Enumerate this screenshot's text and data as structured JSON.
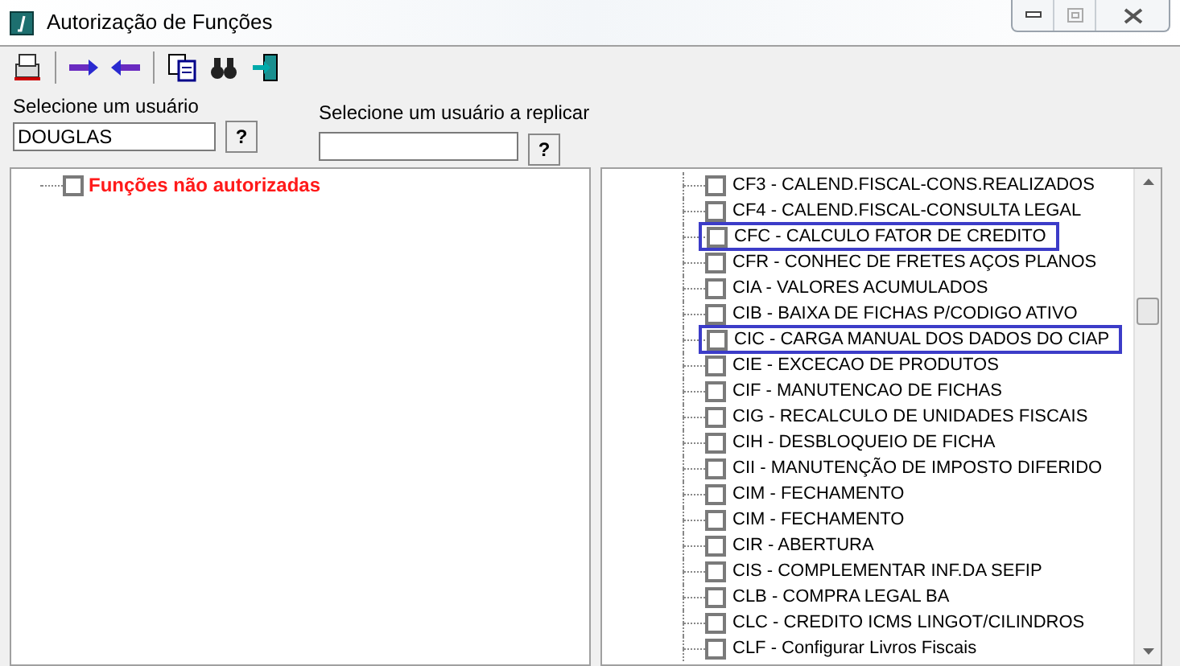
{
  "window": {
    "title": "Autorização de Funções"
  },
  "user_field": {
    "label": "Selecione um usuário",
    "value": "DOUGLAS",
    "button": "?"
  },
  "replicate_field": {
    "label": "Selecione um usuário a replicar",
    "button": "?"
  },
  "left_tree": {
    "items": [
      {
        "label": "Funções não autorizadas",
        "checked": false
      }
    ]
  },
  "right_tree": {
    "items": [
      {
        "label": "CF3 - CALEND.FISCAL-CONS.REALIZADOS",
        "checked": false,
        "highlighted": false
      },
      {
        "label": "CF4 - CALEND.FISCAL-CONSULTA LEGAL",
        "checked": false,
        "highlighted": false
      },
      {
        "label": "CFC - CALCULO FATOR DE CREDITO",
        "checked": false,
        "highlighted": true
      },
      {
        "label": "CFR - CONHEC DE FRETES AÇOS PLANOS",
        "checked": false,
        "highlighted": false
      },
      {
        "label": "CIA - VALORES ACUMULADOS",
        "checked": false,
        "highlighted": false
      },
      {
        "label": "CIB - BAIXA DE FICHAS P/CODIGO ATIVO",
        "checked": false,
        "highlighted": false
      },
      {
        "label": "CIC - CARGA MANUAL DOS DADOS DO CIAP",
        "checked": false,
        "highlighted": true
      },
      {
        "label": "CIE - EXCECAO DE PRODUTOS",
        "checked": false,
        "highlighted": false
      },
      {
        "label": "CIF - MANUTENCAO DE FICHAS",
        "checked": false,
        "highlighted": false
      },
      {
        "label": "CIG - RECALCULO DE UNIDADES FISCAIS",
        "checked": false,
        "highlighted": false
      },
      {
        "label": "CIH - DESBLOQUEIO DE FICHA",
        "checked": false,
        "highlighted": false
      },
      {
        "label": "CII - MANUTENÇÃO DE IMPOSTO DIFERIDO",
        "checked": false,
        "highlighted": false
      },
      {
        "label": "CIM - FECHAMENTO",
        "checked": false,
        "highlighted": false
      },
      {
        "label": "CIM - FECHAMENTO",
        "checked": false,
        "highlighted": false
      },
      {
        "label": "CIR - ABERTURA",
        "checked": false,
        "highlighted": false
      },
      {
        "label": "CIS - COMPLEMENTAR INF.DA SEFIP",
        "checked": false,
        "highlighted": false
      },
      {
        "label": "CLB - COMPRA LEGAL BA",
        "checked": false,
        "highlighted": false
      },
      {
        "label": "CLC - CREDITO ICMS LINGOT/CILINDROS",
        "checked": false,
        "highlighted": false
      },
      {
        "label": "CLF - Configurar Livros Fiscais",
        "checked": false,
        "highlighted": false
      }
    ]
  }
}
